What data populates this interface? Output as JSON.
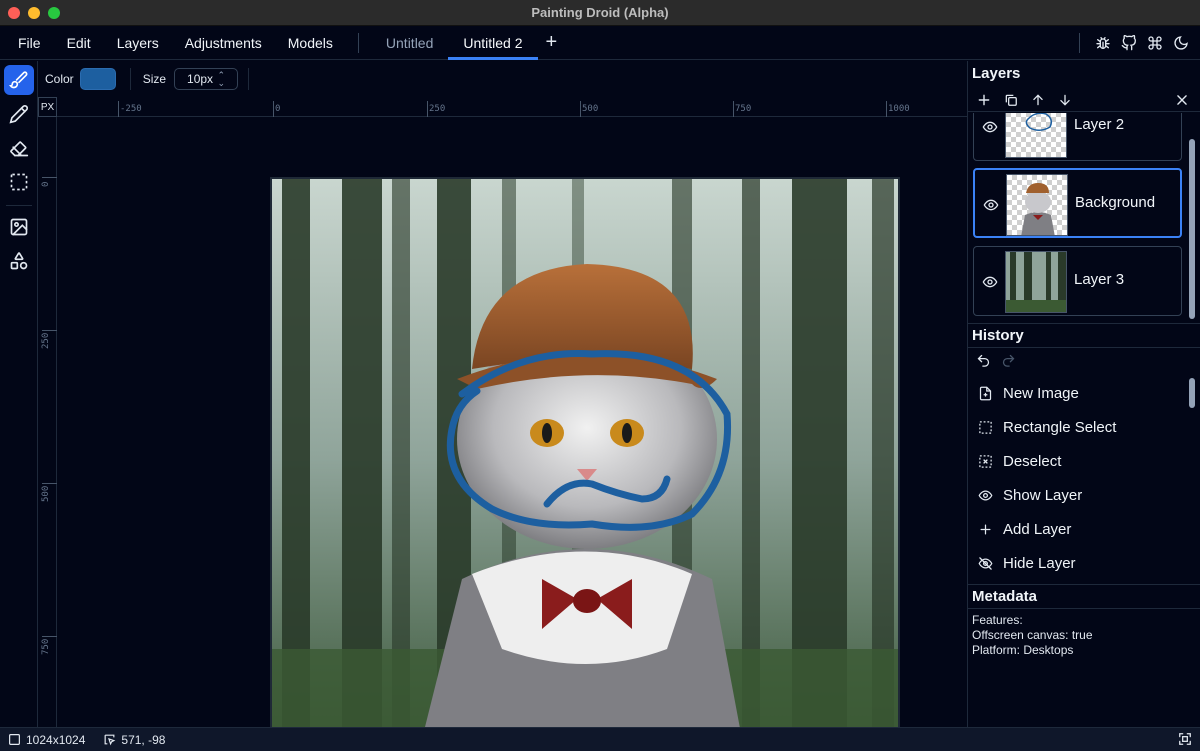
{
  "window": {
    "title": "Painting Droid (Alpha)"
  },
  "menu": {
    "items": [
      "File",
      "Edit",
      "Layers",
      "Adjustments",
      "Models"
    ]
  },
  "tabs": [
    {
      "label": "Untitled",
      "active": false
    },
    {
      "label": "Untitled 2",
      "active": true
    }
  ],
  "header_icons": [
    "bug-icon",
    "github-icon",
    "command-icon",
    "theme-moon-icon"
  ],
  "tools": [
    {
      "name": "brush-tool",
      "active": true
    },
    {
      "name": "pencil-tool",
      "active": false
    },
    {
      "name": "eraser-tool",
      "active": false
    },
    {
      "name": "rectangle-select-tool",
      "active": false
    },
    {
      "name": "image-tool",
      "active": false
    },
    {
      "name": "shapes-tool",
      "active": false
    }
  ],
  "options": {
    "color_label": "Color",
    "color_value": "#1d5fa0",
    "size_label": "Size",
    "size_value": "10px"
  },
  "ruler": {
    "unit": "PX",
    "h_labels": [
      "-250",
      "0",
      "250",
      "500",
      "750",
      "1000"
    ],
    "v_labels": [
      "0",
      "250",
      "500",
      "750"
    ]
  },
  "layers_panel": {
    "title": "Layers",
    "layers": [
      {
        "name": "Layer 2",
        "visible": true,
        "selected": false
      },
      {
        "name": "Background",
        "visible": true,
        "selected": true
      },
      {
        "name": "Layer 3",
        "visible": true,
        "selected": false
      }
    ]
  },
  "history_panel": {
    "title": "History",
    "items": [
      {
        "label": "New Image",
        "icon": "file-plus-icon"
      },
      {
        "label": "Rectangle Select",
        "icon": "select-rect-icon"
      },
      {
        "label": "Deselect",
        "icon": "deselect-icon"
      },
      {
        "label": "Show Layer",
        "icon": "eye-icon"
      },
      {
        "label": "Add Layer",
        "icon": "plus-icon"
      },
      {
        "label": "Hide Layer",
        "icon": "eye-off-icon"
      }
    ]
  },
  "metadata_panel": {
    "title": "Metadata",
    "lines": [
      "Features:",
      "Offscreen canvas: true",
      "Platform: Desktops"
    ]
  },
  "status": {
    "image_size": "1024x1024",
    "cursor_position": "571, -98"
  },
  "colors": {
    "accent": "#3b82f6",
    "background": "#020617",
    "stroke": "#1d5fa0"
  }
}
